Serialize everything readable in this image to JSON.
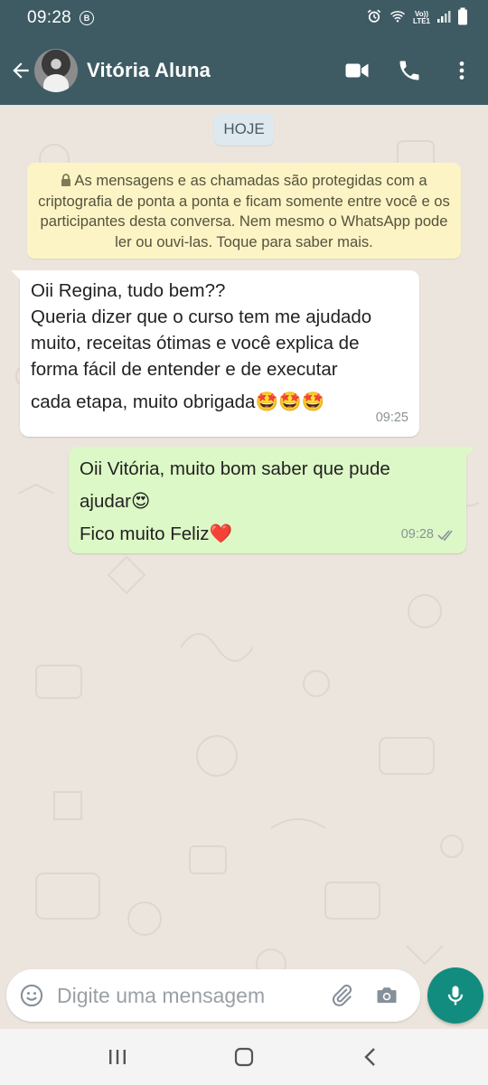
{
  "status_bar": {
    "time": "09:28",
    "badge": "B",
    "network_top": "Vo))",
    "network_bottom": "LTE1"
  },
  "header": {
    "contact_name": "Vitória Aluna",
    "icons": [
      "back-arrow-icon",
      "video-call-icon",
      "phone-icon",
      "more-vert-icon"
    ]
  },
  "chat": {
    "date_chip": "HOJE",
    "encryption_notice": "As mensagens e as chamadas são protegidas com a criptografia de ponta a ponta e ficam somente entre você e os participantes desta conversa. Nem mesmo o WhatsApp pode ler ou ouvi-las. Toque para saber mais.",
    "messages": [
      {
        "direction": "incoming",
        "lines": [
          "Oii Regina, tudo bem??",
          "Queria dizer que o curso tem me ajudado",
          "muito, receitas ótimas e você explica de",
          "forma fácil de entender e de executar",
          "cada etapa, muito obrigada🤩🤩🤩"
        ],
        "time": "09:25"
      },
      {
        "direction": "outgoing",
        "lines": [
          "Oii Vitória, muito bom saber que pude",
          "ajudar😍",
          "Fico muito Feliz❤️"
        ],
        "time": "09:28",
        "status": "read"
      }
    ]
  },
  "composer": {
    "placeholder": "Digite uma mensagem"
  },
  "colors": {
    "header": "#3e5b64",
    "outgoing_bubble": "#dcf8c6",
    "incoming_bubble": "#ffffff",
    "notice": "#fcf4c4",
    "mic_button": "#128c7e"
  }
}
